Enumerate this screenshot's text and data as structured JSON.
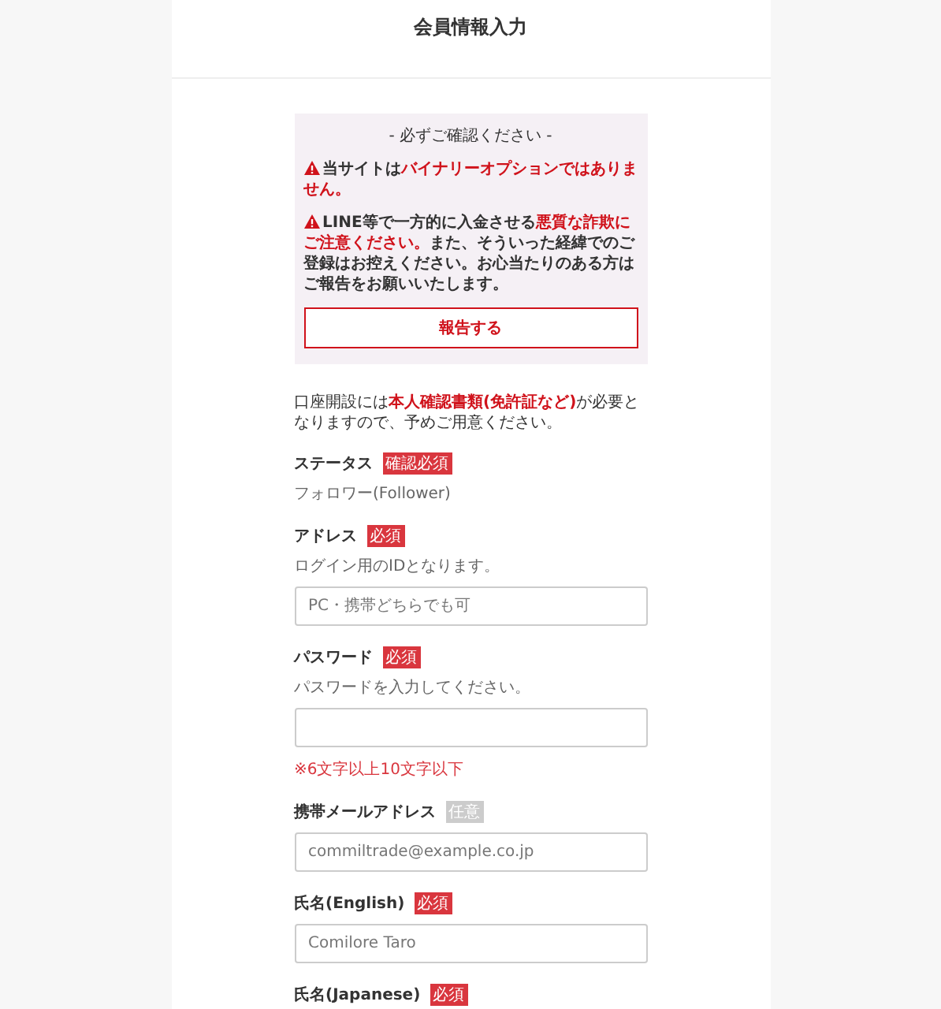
{
  "header": {
    "title": "会員情報入力"
  },
  "notice": {
    "heading": "- 必ずご確認ください -",
    "paragraphs": [
      {
        "warning": true,
        "text": "当サイトは**バイナリーオプションではありません。**"
      },
      {
        "warning": true,
        "text": "LINE等で一方的に入金させる**悪質な詐欺にご注意ください。**また、そういった経緯でのご登録はお控えください。お心当たりのある方はご報告をお願いいたします。"
      }
    ],
    "button": "報告する"
  },
  "intro": "口座開設には**本人確認書類(免許証など)**が必要となりますので、予めご用意ください。",
  "fields": [
    {
      "kind": "static",
      "label": "ステータス",
      "badge": {
        "text": "確認必須",
        "kind": "required"
      },
      "value": "フォロワー(Follower)"
    },
    {
      "kind": "input",
      "label": "アドレス",
      "badge": {
        "text": "必須",
        "kind": "required"
      },
      "hint": "ログイン用のIDとなります。",
      "placeholder": "PC・携帯どちらでも可"
    },
    {
      "kind": "input",
      "label": "パスワード",
      "badge": {
        "text": "必須",
        "kind": "required"
      },
      "hint": "パスワードを入力してください。",
      "note": "※6文字以上10文字以下"
    },
    {
      "kind": "input",
      "label": "携帯メールアドレス",
      "badge": {
        "text": "任意",
        "kind": "optional"
      },
      "placeholder": "commiltrade@example.co.jp"
    },
    {
      "kind": "input",
      "label": "氏名(English)",
      "badge": {
        "text": "必須",
        "kind": "required"
      },
      "placeholder": "Comilore Taro"
    },
    {
      "kind": "label",
      "label": "氏名(Japanese)",
      "badge": {
        "text": "必須",
        "kind": "required"
      }
    }
  ]
}
